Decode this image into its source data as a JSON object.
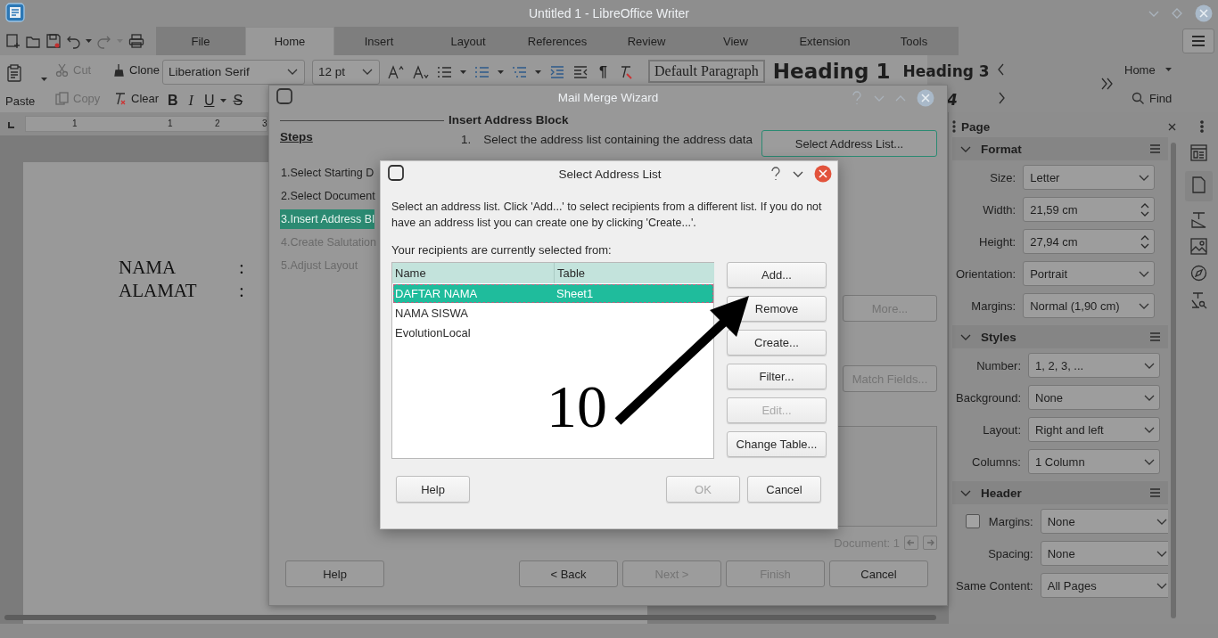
{
  "window": {
    "title": "Untitled 1 - LibreOffice Writer"
  },
  "tabs": [
    {
      "label": "File",
      "selected": false
    },
    {
      "label": "Home",
      "selected": true
    },
    {
      "label": "Insert",
      "selected": false
    },
    {
      "label": "Layout",
      "selected": false
    },
    {
      "label": "References",
      "selected": false
    },
    {
      "label": "Review",
      "selected": false
    },
    {
      "label": "View",
      "selected": false
    },
    {
      "label": "Extension",
      "selected": false
    },
    {
      "label": "Tools",
      "selected": false
    }
  ],
  "ribbon": {
    "paste": "Paste",
    "clipboard": [
      {
        "label": "Cut",
        "disabled": true
      },
      {
        "label": "Copy",
        "disabled": true
      }
    ],
    "clone": "Clone",
    "clear": "Clear",
    "font_name": "Liberation Serif",
    "font_size": "12 pt",
    "paragraph_mark": "¶",
    "format_buttons": [
      {
        "label": "B",
        "kind": "bold"
      },
      {
        "label": "I",
        "kind": "italic"
      },
      {
        "label": "U",
        "kind": "underline"
      },
      {
        "label": "S",
        "kind": "strike"
      }
    ],
    "styles": [
      {
        "label": "Default Paragraph",
        "kind": "default"
      },
      {
        "label": "Heading 1",
        "kind": "h1"
      },
      {
        "label": "Heading 3",
        "kind": "h3"
      }
    ],
    "styles_row2": [
      {
        "label": "4",
        "kind": "h4"
      }
    ],
    "context_menu": "Home",
    "find": "Find"
  },
  "ruler": {
    "ticks": [
      "1",
      "1",
      "2",
      "3"
    ]
  },
  "document": {
    "lines": [
      {
        "label": "NAMA",
        "colon": ":"
      },
      {
        "label": "ALAMAT",
        "colon": ":"
      }
    ]
  },
  "sidebar": {
    "title": "Page",
    "sections": [
      {
        "title": "Format",
        "expanded": true,
        "fields": [
          {
            "label": "Size:",
            "value": "Letter",
            "kind": "dropdown"
          },
          {
            "label": "Width:",
            "value": "21,59 cm",
            "kind": "spin"
          },
          {
            "label": "Height:",
            "value": "27,94 cm",
            "kind": "spin"
          },
          {
            "label": "Orientation:",
            "value": "Portrait",
            "kind": "dropdown"
          },
          {
            "label": "Margins:",
            "value": "Normal (1,90 cm)",
            "kind": "dropdown"
          }
        ]
      },
      {
        "title": "Styles",
        "expanded": true,
        "fields": [
          {
            "label": "Number:",
            "value": "1, 2, 3, ...",
            "kind": "dropdown"
          },
          {
            "label": "Background:",
            "value": "None",
            "kind": "dropdown"
          },
          {
            "label": "Layout:",
            "value": "Right and left",
            "kind": "dropdown"
          },
          {
            "label": "Columns:",
            "value": "1 Column",
            "kind": "dropdown"
          }
        ]
      },
      {
        "title": "Header",
        "expanded": true,
        "fields": [
          {
            "label": "Margins:",
            "value": "None",
            "kind": "check-dropdown",
            "checked": false
          },
          {
            "label": "Spacing:",
            "value": "None",
            "kind": "dropdown"
          },
          {
            "label": "Same Content:",
            "value": "All Pages",
            "kind": "dropdown"
          }
        ]
      }
    ]
  },
  "wizard": {
    "title": "Mail Merge Wizard",
    "steps_heading": "Steps",
    "steps": [
      {
        "label": "1.Select Starting D",
        "selected": false,
        "disabled": false
      },
      {
        "label": "2.Select Document",
        "selected": false,
        "disabled": false
      },
      {
        "label": "3.Insert Address Bl",
        "selected": true,
        "disabled": false
      },
      {
        "label": "4.Create Salutation",
        "selected": false,
        "disabled": true
      },
      {
        "label": "5.Adjust Layout",
        "selected": false,
        "disabled": true
      }
    ],
    "heading": "Insert Address Block",
    "instruction_number": "1.",
    "instruction": "Select the address list containing the address data",
    "select_button": "Select Address List...",
    "more_button": "More...",
    "match_button": "Match Fields...",
    "document_label": "Document: 1",
    "buttons": [
      {
        "label": "Help",
        "disabled": false
      },
      {
        "label": "< Back",
        "disabled": false
      },
      {
        "label": "Next >",
        "disabled": true
      },
      {
        "label": "Finish",
        "disabled": true
      },
      {
        "label": "Cancel",
        "disabled": false
      }
    ]
  },
  "dialog": {
    "title": "Select Address List",
    "description": "Select an address list. Click 'Add...' to select recipients from a different list. If you do not have an address list you can create one by clicking 'Create...'.",
    "list_label": "Your recipients are currently selected from:",
    "columns": [
      "Name",
      "Table"
    ],
    "rows": [
      {
        "name": "DAFTAR NAMA",
        "table": "Sheet1",
        "selected": true
      },
      {
        "name": "NAMA SISWA",
        "selected": false
      },
      {
        "name": "EvolutionLocal",
        "selected": false
      }
    ],
    "side_buttons": [
      {
        "label": "Add...",
        "disabled": false
      },
      {
        "label": "Remove",
        "disabled": false
      },
      {
        "label": "Create...",
        "disabled": false
      },
      {
        "label": "Filter...",
        "disabled": false
      },
      {
        "label": "Edit...",
        "disabled": true
      },
      {
        "label": "Change Table...",
        "disabled": false
      }
    ],
    "help": "Help",
    "ok": {
      "label": "OK",
      "disabled": true
    },
    "cancel": "Cancel"
  },
  "annotation": {
    "label": "10"
  }
}
